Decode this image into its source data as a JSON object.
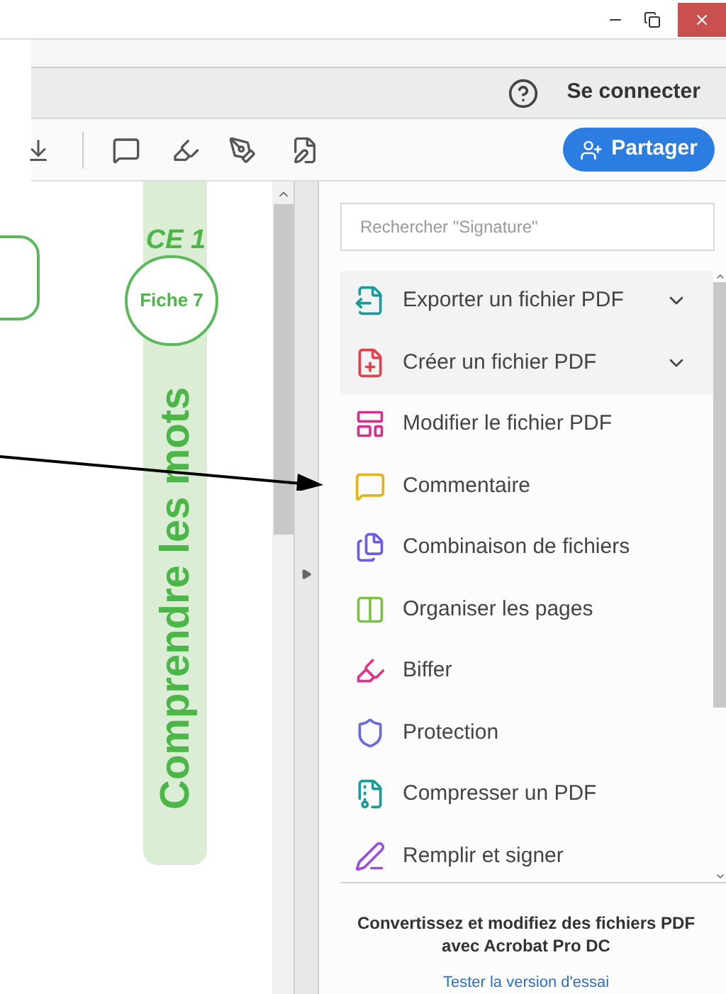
{
  "header": {
    "sign_in": "Se connecter"
  },
  "toolbar": {
    "share_button": "Partager"
  },
  "document": {
    "grade": "CE 1",
    "badge": "Fiche 7",
    "vertical_title": "Comprendre les mots"
  },
  "tools_panel": {
    "search": {
      "placeholder": "Rechercher \"Signature\""
    },
    "tools": [
      {
        "label": "Exporter un fichier PDF",
        "expandable": true
      },
      {
        "label": "Créer un fichier PDF",
        "expandable": true
      },
      {
        "label": "Modifier le fichier PDF",
        "expandable": false
      },
      {
        "label": "Commentaire",
        "expandable": false
      },
      {
        "label": "Combinaison de fichiers",
        "expandable": false
      },
      {
        "label": "Organiser les pages",
        "expandable": false
      },
      {
        "label": "Biffer",
        "expandable": false
      },
      {
        "label": "Protection",
        "expandable": false
      },
      {
        "label": "Compresser un PDF",
        "expandable": false
      },
      {
        "label": "Remplir et signer",
        "expandable": false
      }
    ],
    "promo": {
      "text": "Convertissez et modifiez des fichiers PDF avec Acrobat Pro DC",
      "link": "Tester la version d'essai"
    }
  }
}
